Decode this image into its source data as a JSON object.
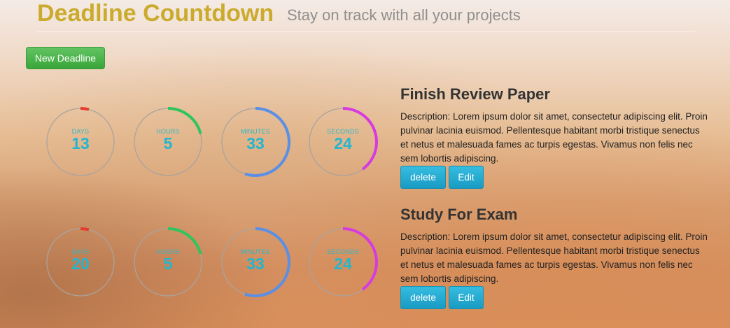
{
  "header": {
    "title": "Deadline Countdown",
    "subtitle": "Stay on track with all your projects"
  },
  "toolbar": {
    "new_label": "New Deadline"
  },
  "colors": {
    "title": "#cbab2d",
    "days_arc": "#e43d2f",
    "hours_arc": "#2fc45c",
    "minutes_arc": "#5a8fe6",
    "seconds_arc": "#d63be0",
    "number": "#23b6cf"
  },
  "deadlines": [
    {
      "title": "Finish Review Paper",
      "description": "Description: Lorem ipsum dolor sit amet, consectetur adipiscing elit. Proin pulvinar lacinia euismod. Pellentesque habitant morbi tristique senectus et netus et malesuada fames ac turpis egestas. Vivamus non felis nec sem lobortis adipiscing.",
      "delete_label": "delete",
      "edit_label": "Edit",
      "timers": [
        {
          "unit": "DAYS",
          "value": "13",
          "progress": 0.04
        },
        {
          "unit": "HOURS",
          "value": "5",
          "progress": 0.21
        },
        {
          "unit": "MINUTES",
          "value": "33",
          "progress": 0.55
        },
        {
          "unit": "SECONDS",
          "value": "24",
          "progress": 0.4
        }
      ]
    },
    {
      "title": "Study For Exam",
      "description": "Description: Lorem ipsum dolor sit amet, consectetur adipiscing elit. Proin pulvinar lacinia euismod. Pellentesque habitant morbi tristique senectus et netus et malesuada fames ac turpis egestas. Vivamus non felis nec sem lobortis adipiscing.",
      "delete_label": "delete",
      "edit_label": "Edit",
      "timers": [
        {
          "unit": "DAYS",
          "value": "20",
          "progress": 0.04
        },
        {
          "unit": "HOURS",
          "value": "5",
          "progress": 0.21
        },
        {
          "unit": "MINUTES",
          "value": "33",
          "progress": 0.55
        },
        {
          "unit": "SECONDS",
          "value": "24",
          "progress": 0.4
        }
      ]
    }
  ]
}
